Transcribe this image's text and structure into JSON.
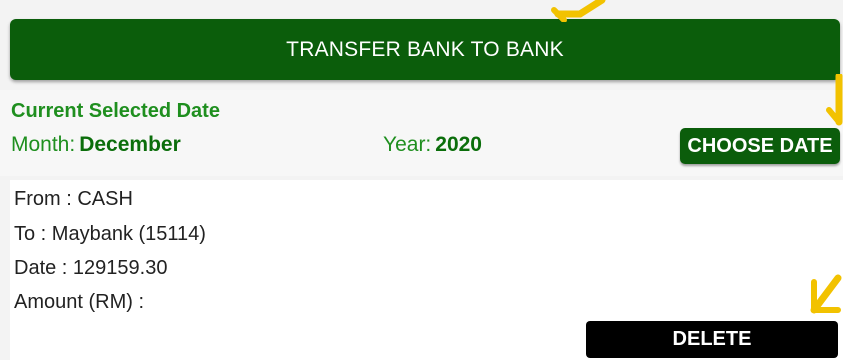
{
  "header": {
    "title": "TRANSFER BANK TO BANK"
  },
  "date_section": {
    "label": "Current Selected Date",
    "month_label": "Month:",
    "month_value": "December",
    "year_label": "Year:",
    "year_value": "2020",
    "choose_button": "CHOOSE DATE"
  },
  "record": {
    "from": "From : CASH",
    "to": "To : Maybank (15114)",
    "date": "Date : 129159.30",
    "amount": "Amount (RM) :",
    "delete_button": "DELETE"
  },
  "annotation_color": "#f2c200",
  "accent_color": "#0b5d0b"
}
